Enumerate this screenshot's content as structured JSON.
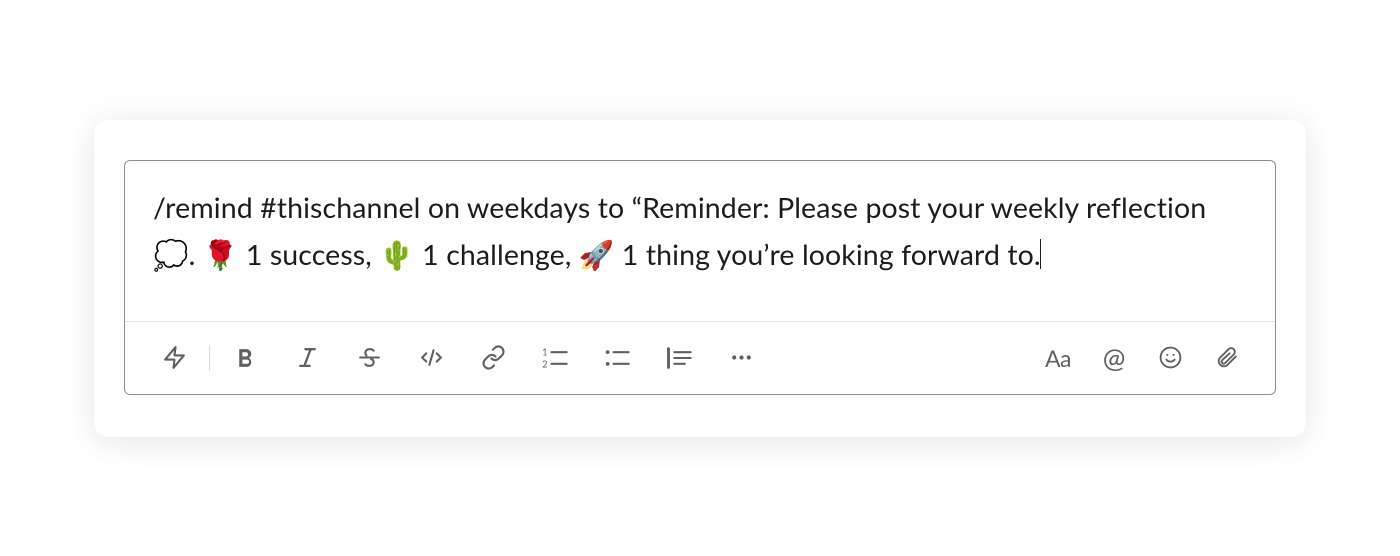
{
  "composer": {
    "text_before_bubble": "/remind #thischannel on weekdays to “Reminder: Please post your weekly reflection ",
    "emoji_bubble": "💭",
    "text_after_bubble": ". ",
    "emoji_rose": "🌹",
    "text_success": " 1 success, ",
    "emoji_cactus": "🌵",
    "text_challenge": " 1 challenge, ",
    "emoji_rocket": "🚀",
    "text_forward": " 1 thing you’re looking forward to."
  },
  "toolbar": {
    "shortcut": "Shortcuts",
    "bold": "Bold",
    "italic": "Italic",
    "strike": "Strikethrough",
    "code": "Code",
    "link": "Link",
    "ol": "Ordered list",
    "ul": "Bulleted list",
    "quote": "Blockquote",
    "more": "More",
    "aa": "Aa",
    "mention": "@",
    "emoji": "Emoji",
    "attach": "Attach"
  }
}
